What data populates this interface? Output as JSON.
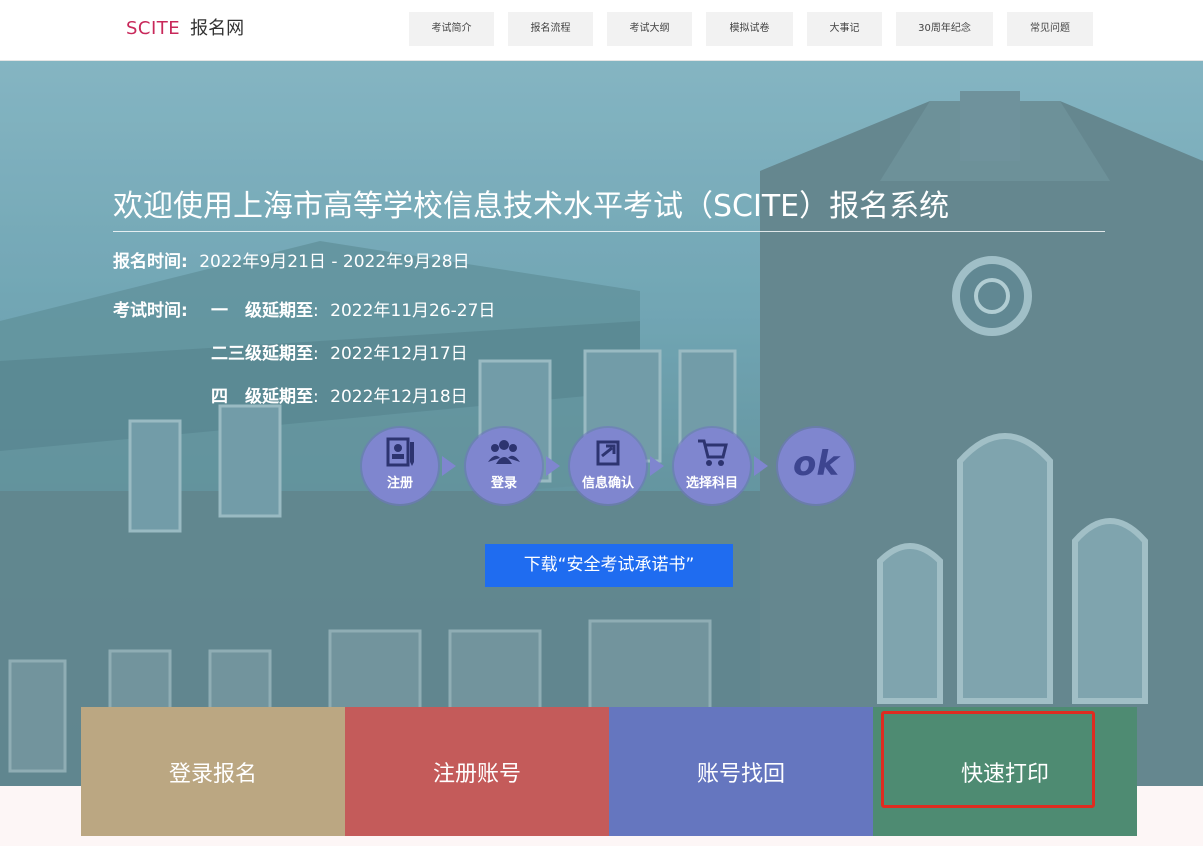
{
  "header": {
    "brand": "SCITE",
    "site_name": "报名网",
    "nav": [
      {
        "label": "考试简介"
      },
      {
        "label": "报名流程"
      },
      {
        "label": "考试大纲"
      },
      {
        "label": "模拟试卷"
      },
      {
        "label": "大事记"
      },
      {
        "label": "30周年纪念"
      },
      {
        "label": "常见问题"
      }
    ]
  },
  "hero": {
    "title": "欢迎使用上海市高等学校信息技术水平考试（SCITE）报名系统",
    "registration": {
      "label": "报名时间:",
      "value": "2022年9月21日 - 2022年9月28日"
    },
    "exam": {
      "label": "考试时间:",
      "rows": [
        {
          "level": "一　级延期至",
          "sep": ":",
          "date": "2022年11月26-27日"
        },
        {
          "level": "二三级延期至",
          "sep": ":",
          "date": "2022年12月17日"
        },
        {
          "level": "四　级延期至",
          "sep": ":",
          "date": "2022年12月18日"
        }
      ]
    },
    "steps": [
      {
        "label": "注册",
        "icon": "register-card-icon"
      },
      {
        "label": "登录",
        "icon": "users-icon"
      },
      {
        "label": "信息确认",
        "icon": "confirm-arrow-icon"
      },
      {
        "label": "选择科目",
        "icon": "cart-icon"
      },
      {
        "label": "ok",
        "icon": "ok-text"
      }
    ],
    "download_label": "下载“安全考试承诺书”"
  },
  "tiles": [
    {
      "label": "登录报名",
      "color": "#bba782"
    },
    {
      "label": "注册账号",
      "color": "#c45b5a"
    },
    {
      "label": "账号找回",
      "color": "#6576bf"
    },
    {
      "label": "快速打印",
      "color": "#4e8b72"
    }
  ],
  "colors": {
    "brand": "#c8285a",
    "download_button": "#1f6cf0",
    "highlight": "#e02b20"
  }
}
